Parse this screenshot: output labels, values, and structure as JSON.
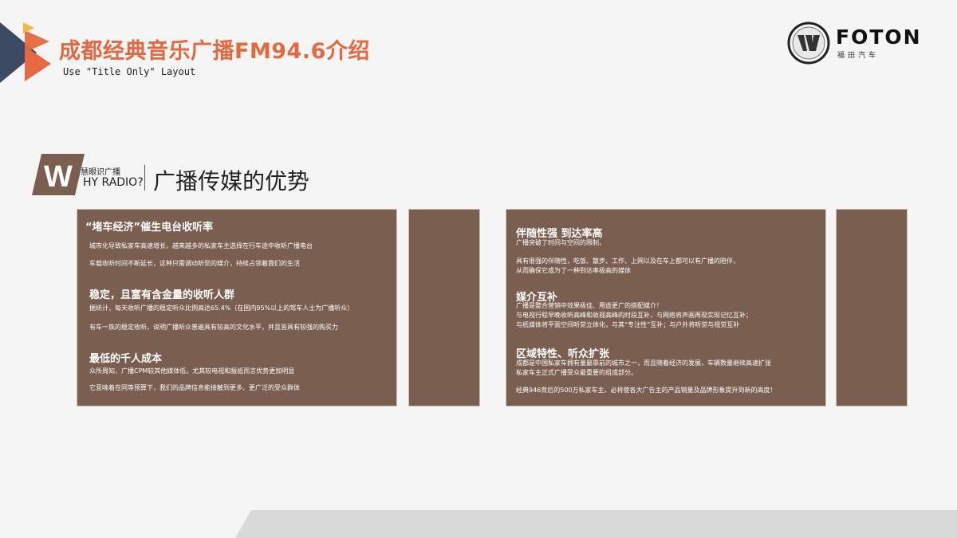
{
  "header": {
    "title": "成都经典音乐广播FM94.6介绍",
    "subtitle": "Use \"Title Only\" Layout"
  },
  "logo": {
    "name": "FOTON",
    "subtext": "福田汽车"
  },
  "section": {
    "badge_letter": "W",
    "badge_top": "慧眼识广播",
    "badge_bottom": "HY RADIO?",
    "title": "广播传媒的优势"
  },
  "left_panel": {
    "h1": "“堵车经济”催生电台收听率",
    "p1": "城市化导致私家车高速增长，越来越多的私家车主选择在行车途中收听广播电台",
    "p2": "车载收听时间不断延长，这种只需调动听觉的媒介，持续占领着我们的生活",
    "h2": "稳定，且富有含金量的收听人群",
    "p3": "据统计，每天收听广播的稳定听众比例高达65.4%（在国内95%以上的驾车人士为广播听众）",
    "p4": "有车一族的稳定收听，说明广播听众普遍具有较高的文化水平，并且皆具有较强的购买力",
    "h3": "最低的千人成本",
    "p5": "众所周知，广播CPM较其他媒体低，尤其较电视和报纸而言优势更加明显",
    "p6": "它意味着在同等预算下，我们的品牌信息能接触到更多、更广泛的受众群体"
  },
  "right_panel": {
    "h1": "伴随性强 到达率高",
    "p1": "广播突破了时间与空间的限制，",
    "p2": "具有很强的伴随性，吃饭、散步、工作、上网以及在车上都可以有广播的陪伴，",
    "p3": "从而确保它成为了一种到达率极高的媒体",
    "h2": "媒介互补",
    "p4": "广播是整合营销中效果极佳、用途更广的搭配媒介！",
    "p5": "与电视行程早晚收听高峰和收视高峰的时段互补，与网络将声画再现实现记忆互补；",
    "p6": "与纸媒体将平面空间听觉立体化，与其“专注性”互补；与户外将听觉与视觉互补",
    "h3": "区域特性、听众扩张",
    "p7": "成都是中国私家车拥有量最靠前的城市之一，而且随着经济的发展，车辆数量继续高速扩张",
    "p8": "私家车主正式广播受众最重要的组成部分。",
    "p9": "经典946背后的500万私家车主，必将使各大广告主的产品销量及品牌形象提升到新的高度！"
  },
  "colors": {
    "accent": "#e5683e",
    "box_brown": "#7a5e50",
    "navy": "#3c4a63",
    "yellow": "#f6b93b",
    "background": "#f5f5f5"
  }
}
